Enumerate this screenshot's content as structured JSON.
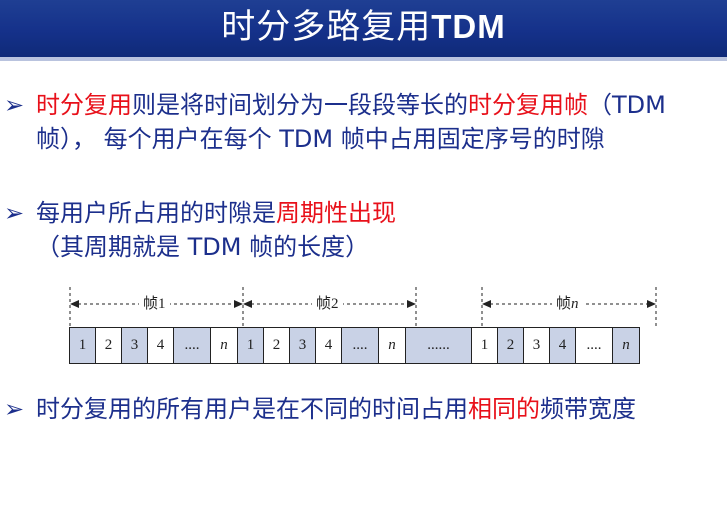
{
  "title": {
    "cn": "时分多路复用",
    "latin": "TDM"
  },
  "bullet_mark": "➢",
  "bullets": [
    {
      "parts": [
        {
          "text": "时分复用",
          "style": "red"
        },
        {
          "text": "则是将时间划分为一段段等长的",
          "style": "normal"
        },
        {
          "text": "时分复用帧",
          "style": "red"
        },
        {
          "text": "（TDM 帧）， 每个用户在每个 TDM 帧中占用固定序号的时隙",
          "style": "normal"
        }
      ]
    },
    {
      "parts": [
        {
          "text": "每用户所占用的时隙是",
          "style": "normal"
        },
        {
          "text": "周期性出现",
          "style": "red"
        },
        {
          "text": "（其周期就是 TDM 帧的长度）",
          "style": "normal"
        }
      ]
    },
    {
      "parts": [
        {
          "text": "时分复用的所有用户是在不同的时间占用",
          "style": "normal"
        },
        {
          "text": "相同的",
          "style": "red"
        },
        {
          "text": "频带宽度",
          "style": "normal"
        }
      ]
    }
  ],
  "diagram": {
    "frames": [
      {
        "label": "帧1"
      },
      {
        "label": "帧2"
      },
      {
        "label_prefix": "帧",
        "label_italic": "n"
      }
    ],
    "cells": [
      {
        "text": "1",
        "shade": true
      },
      {
        "text": "2",
        "shade": false
      },
      {
        "text": "3",
        "shade": true
      },
      {
        "text": "4",
        "shade": false
      },
      {
        "text": "....",
        "shade": true
      },
      {
        "text": "n",
        "shade": false,
        "italic": true
      },
      {
        "text": "1",
        "shade": true
      },
      {
        "text": "2",
        "shade": false
      },
      {
        "text": "3",
        "shade": true
      },
      {
        "text": "4",
        "shade": false
      },
      {
        "text": "....",
        "shade": true
      },
      {
        "text": "n",
        "shade": false,
        "italic": true
      },
      {
        "text": "......",
        "shade": true
      },
      {
        "text": "1",
        "shade": false
      },
      {
        "text": "2",
        "shade": true
      },
      {
        "text": "3",
        "shade": false
      },
      {
        "text": "4",
        "shade": true
      },
      {
        "text": "....",
        "shade": false
      },
      {
        "text": "n",
        "shade": true,
        "italic": true
      }
    ]
  },
  "colors": {
    "title_bg": "#15318a",
    "text": "#1c2f8c",
    "highlight": "#e8101a",
    "cell_shade": "#c9d2e6"
  }
}
